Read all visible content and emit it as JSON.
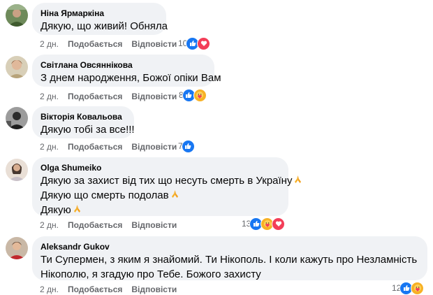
{
  "comments": [
    {
      "author": "Ніна Ярмаркіна",
      "lines": [
        "Дякую, що живий! Обняла"
      ],
      "time": "2 дн.",
      "like_label": "Подобається",
      "reply_label": "Відповісти",
      "reaction_count": "10",
      "reactions": [
        "like-icon",
        "love-icon"
      ]
    },
    {
      "author": "Світлана Овсяннікова",
      "lines": [
        "З днем народження, Божої опіки Вам"
      ],
      "time": "2 дн.",
      "like_label": "Подобається",
      "reply_label": "Відповісти",
      "reaction_count": "8",
      "reactions": [
        "like-icon",
        "care-icon"
      ]
    },
    {
      "author": "Вікторія Ковальова",
      "lines": [
        "Дякую тобі за все!!!"
      ],
      "time": "2 дн.",
      "like_label": "Подобається",
      "reply_label": "Відповісти",
      "reaction_count": "7",
      "reactions": [
        "like-icon"
      ]
    },
    {
      "author": "Olga Shumeiko",
      "lines": [
        "Дякую за захист від тих що несуть смерть в Україну",
        "Дякую що смерть подолав",
        "Дякую"
      ],
      "line_emoji": [
        "pray",
        "pray",
        "pray"
      ],
      "time": "2 дн.",
      "like_label": "Подобається",
      "reply_label": "Відповісти",
      "reaction_count": "13",
      "reactions": [
        "like-icon",
        "care-icon",
        "love-icon"
      ]
    },
    {
      "author": "Aleksandr Gukov",
      "lines": [
        "Ти Супермен, з яким я знайомий. Ти Нікополь. І коли кажуть про Незламність",
        "Нікополю, я згадую про Тебе. Божого захисту"
      ],
      "time": "2 дн.",
      "like_label": "Подобається",
      "reply_label": "Відповісти",
      "reaction_count": "12",
      "reactions": [
        "like-icon",
        "care-icon"
      ]
    }
  ],
  "colors": {
    "bubble": "#f0f2f5",
    "meta_text": "#65676b",
    "like": "#1877f2",
    "love": "#f33e58",
    "care": "#f7b125"
  }
}
